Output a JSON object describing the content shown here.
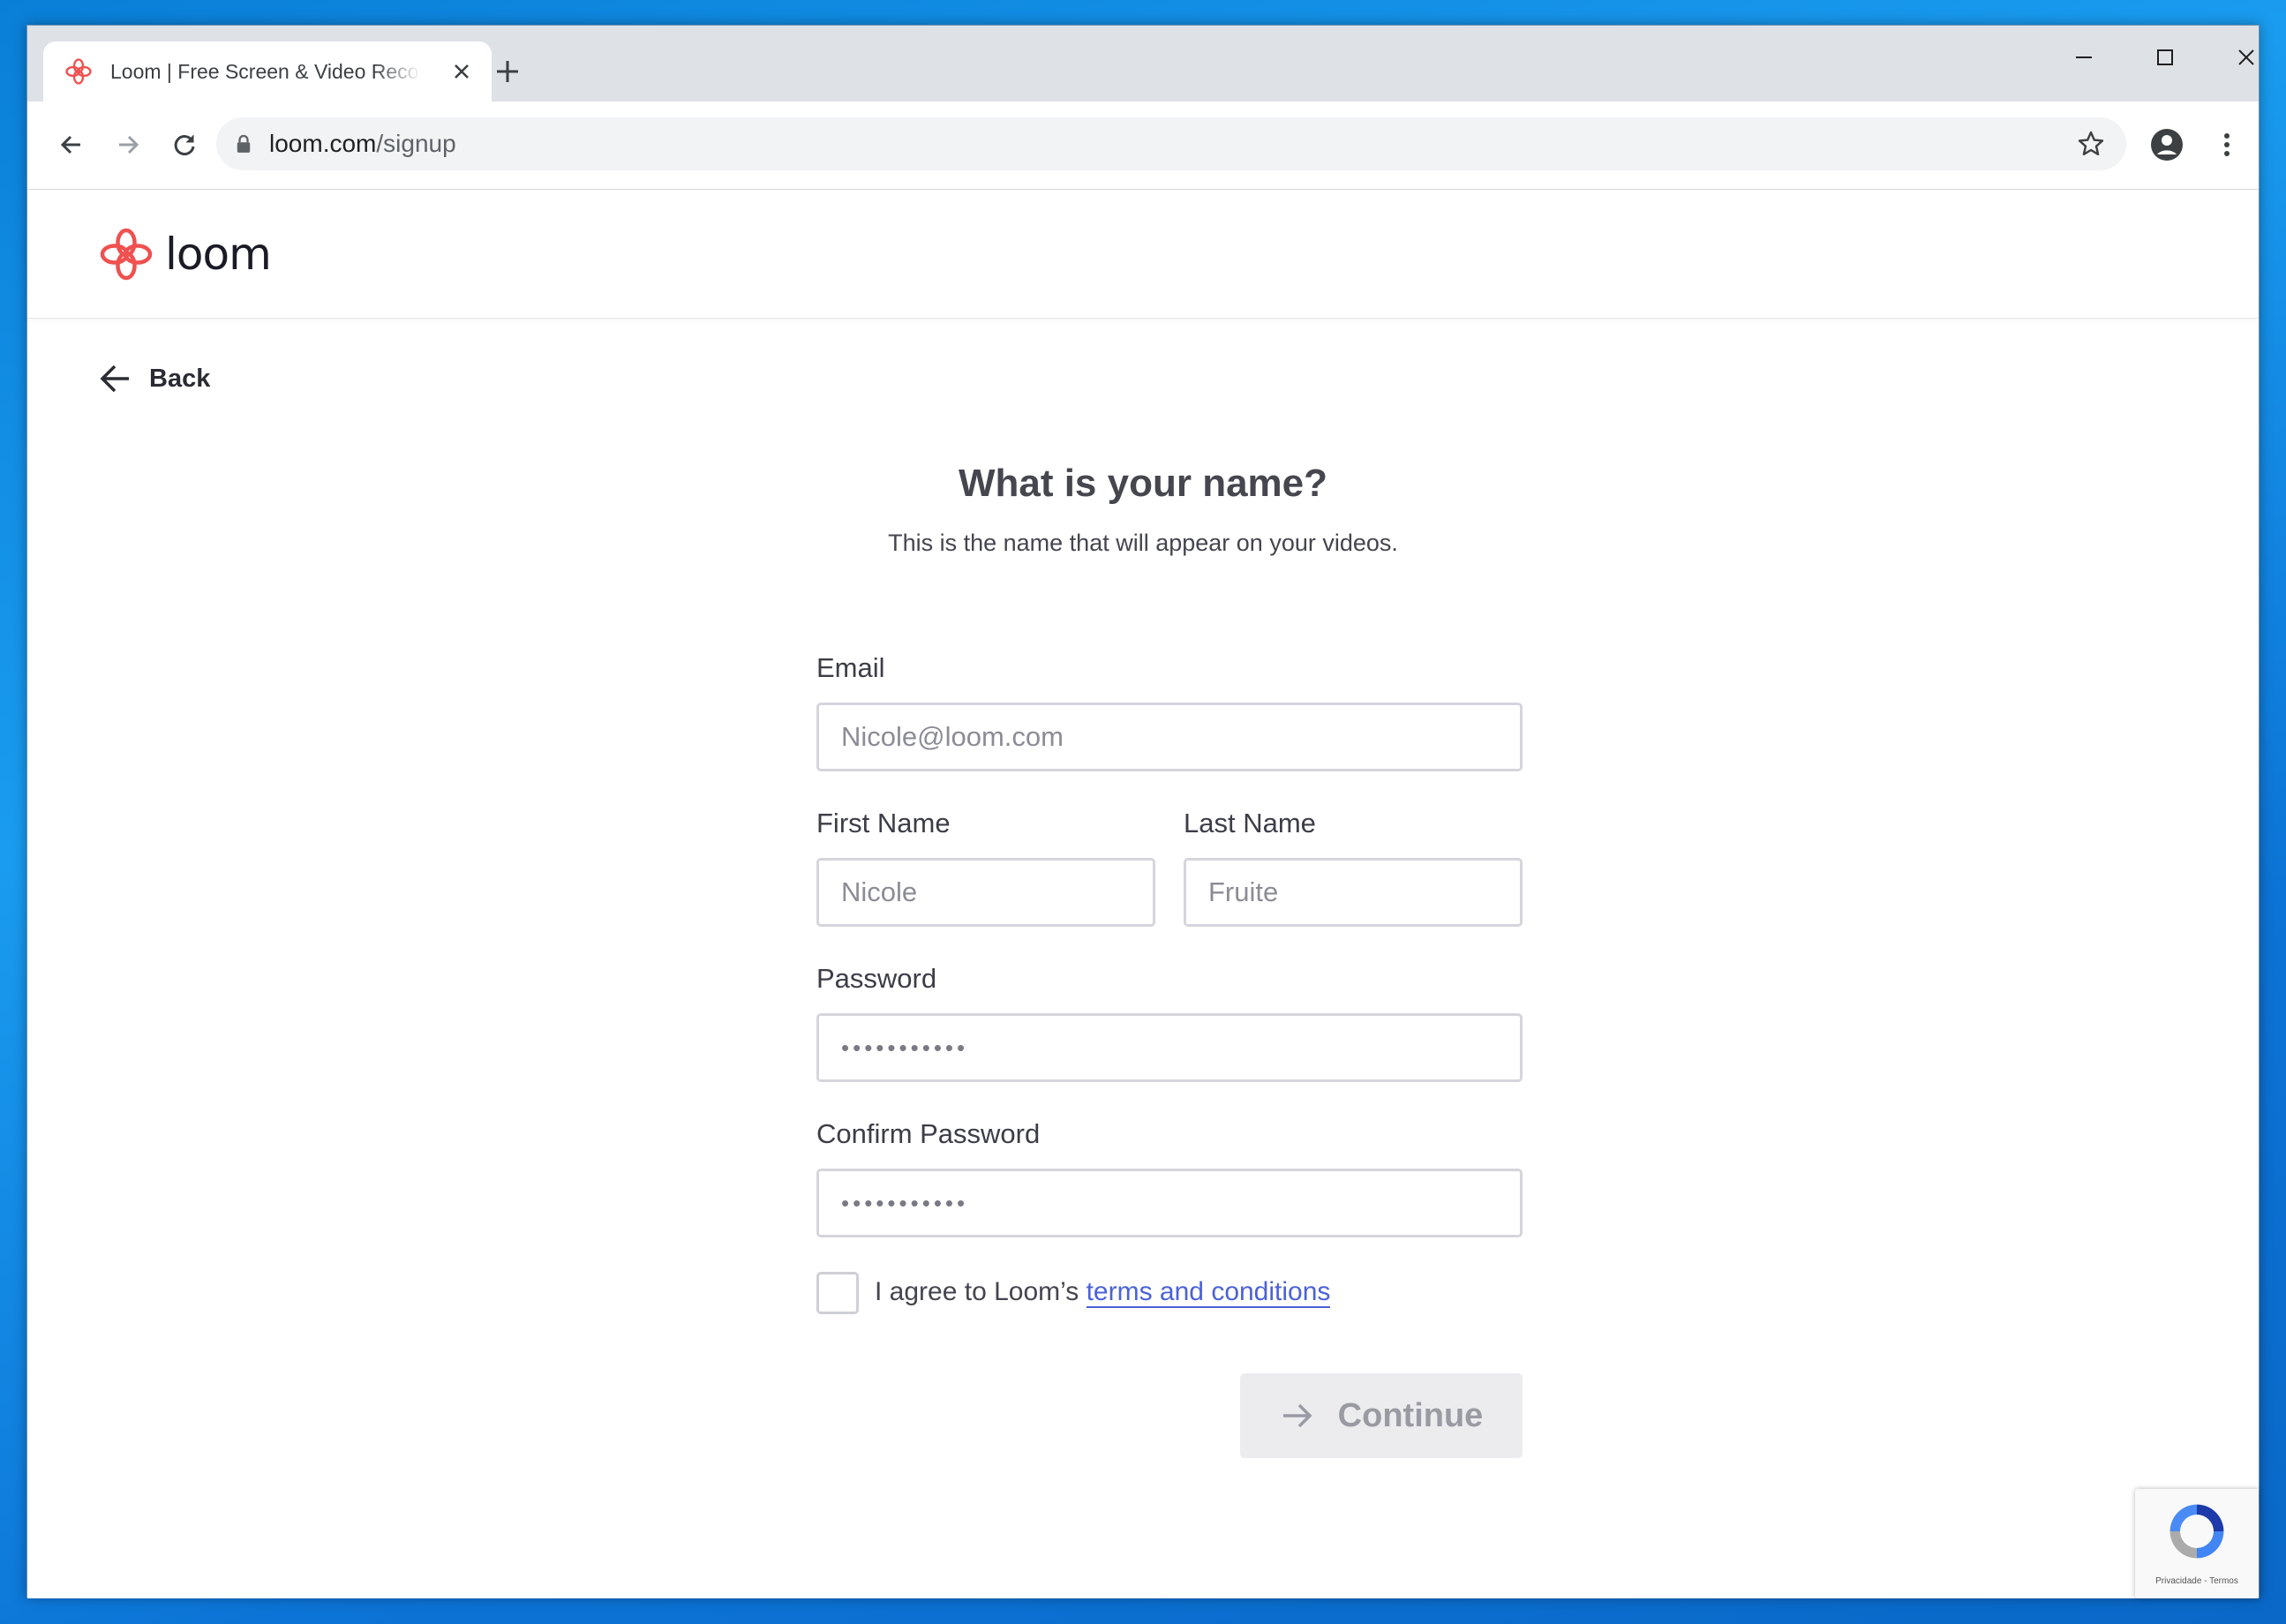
{
  "browser": {
    "tab_title": "Loom | Free Screen & Video Recording Software",
    "url_host": "loom.com",
    "url_path": "/signup"
  },
  "header": {
    "logo_text": "loom"
  },
  "page": {
    "back_label": "Back",
    "heading": "What is your name?",
    "subheading": "This is the name that will appear on your videos.",
    "form": {
      "email_label": "Email",
      "email_placeholder": "Nicole@loom.com",
      "first_name_label": "First Name",
      "first_name_placeholder": "Nicole",
      "last_name_label": "Last Name",
      "last_name_placeholder": "Fruite",
      "password_label": "Password",
      "password_value": "•••••••••••",
      "confirm_password_label": "Confirm Password",
      "confirm_password_value": "•••••••••••",
      "agree_text": "I agree to Loom’s ",
      "terms_link": "terms and conditions",
      "continue_label": "Continue"
    },
    "recaptcha_links": "Privacidade - Termos"
  },
  "colors": {
    "brand": "#f0504f",
    "link": "#4b62d6",
    "button_disabled_bg": "#ececef",
    "desktop": "#0a7fd8"
  }
}
